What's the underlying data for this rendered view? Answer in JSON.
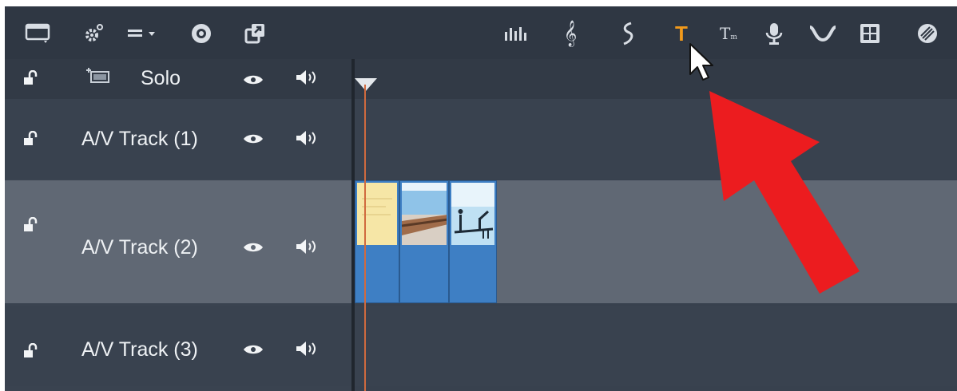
{
  "toolbar": {
    "left_tools": [
      "storyboard-view-icon",
      "settings-icon",
      "track-options-icon",
      "disc-icon",
      "export-icon"
    ],
    "right_tools": [
      "audio-mixer-icon",
      "music-icon",
      "soundtrack-icon",
      "title-editor-icon",
      "theme-editor-icon",
      "voice-over-icon",
      "waveform-icon",
      "grid-icon",
      "effects-icon"
    ],
    "highlighted_tool": "title-editor-icon",
    "highlight_color": "#f29a1b"
  },
  "tracks": {
    "solo_label": "Solo",
    "track1_label": "A/V Track (1)",
    "track2_label": "A/V Track (2)",
    "track3_label": "A/V Track (3)"
  },
  "clips": [
    {
      "id": "clip-1",
      "thumb": "yellow-note"
    },
    {
      "id": "clip-2",
      "thumb": "beach-pier"
    },
    {
      "id": "clip-3",
      "thumb": "blue-sky-silhouette"
    }
  ],
  "annotation": {
    "arrow_color": "#ec1c1f"
  }
}
